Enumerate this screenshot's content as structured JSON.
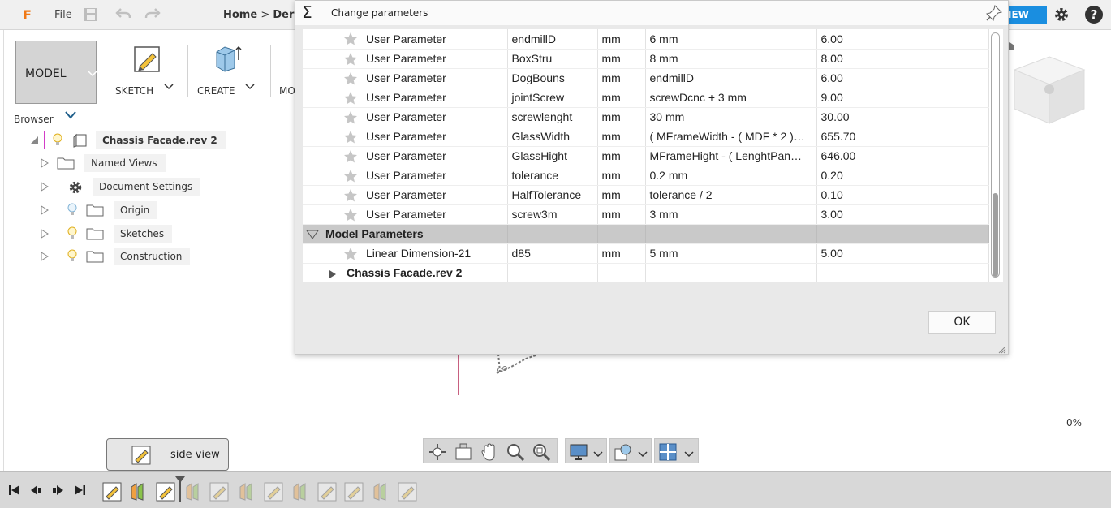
{
  "topbar": {
    "file_label": "File",
    "breadcrumb_home": "Home",
    "breadcrumb_sep": ">",
    "breadcrumb_next": "Der",
    "view_label": "IEW",
    "help_label": "?"
  },
  "workspace": {
    "model_label": "MODEL",
    "tools": [
      {
        "label": "SKETCH"
      },
      {
        "label": "CREATE"
      },
      {
        "label": "MO"
      }
    ]
  },
  "browser": {
    "label": "Browser",
    "root": "Chassis Facade.rev 2",
    "items": [
      {
        "label": "Named Views"
      },
      {
        "label": "Document Settings"
      },
      {
        "label": "Origin"
      },
      {
        "label": "Sketches"
      },
      {
        "label": "Construction"
      }
    ]
  },
  "dialog": {
    "title": "Change parameters",
    "ok_label": "OK",
    "rows": [
      {
        "name": "User Parameter",
        "param": "endmillD",
        "unit": "mm",
        "expr": "6 mm",
        "value": "6.00"
      },
      {
        "name": "User Parameter",
        "param": "BoxStru",
        "unit": "mm",
        "expr": "8 mm",
        "value": "8.00"
      },
      {
        "name": "User Parameter",
        "param": "DogBouns",
        "unit": "mm",
        "expr": "endmillD",
        "value": "6.00"
      },
      {
        "name": "User Parameter",
        "param": "jointScrew",
        "unit": "mm",
        "expr": "screwDcnc + 3 mm",
        "value": "9.00"
      },
      {
        "name": "User Parameter",
        "param": "screwlenght",
        "unit": "mm",
        "expr": "30 mm",
        "value": "30.00"
      },
      {
        "name": "User Parameter",
        "param": "GlassWidth",
        "unit": "mm",
        "expr": "( MFrameWidth - ( MDF * 2 )…",
        "value": "655.70"
      },
      {
        "name": "User Parameter",
        "param": "GlassHight",
        "unit": "mm",
        "expr": "MFrameHight - ( LenghtPan…",
        "value": "646.00"
      },
      {
        "name": "User Parameter",
        "param": "tolerance",
        "unit": "mm",
        "expr": "0.2 mm",
        "value": "0.20"
      },
      {
        "name": "User Parameter",
        "param": "HalfTolerance",
        "unit": "mm",
        "expr": "tolerance / 2",
        "value": "0.10"
      },
      {
        "name": "User Parameter",
        "param": "screw3m",
        "unit": "mm",
        "expr": "3 mm",
        "value": "3.00"
      }
    ],
    "section_label": "Model Parameters",
    "model_rows": [
      {
        "name": "Linear Dimension-21",
        "param": "d85",
        "unit": "mm",
        "expr": "5 mm",
        "value": "5.00"
      }
    ],
    "sub_component": "Chassis Facade.rev 2"
  },
  "status": {
    "percent": "0%"
  },
  "tooltip": {
    "text": "side view"
  },
  "colors": {
    "accent": "#1a8ee0",
    "logo": "#f07814",
    "section_bg": "#c9c9c9"
  }
}
